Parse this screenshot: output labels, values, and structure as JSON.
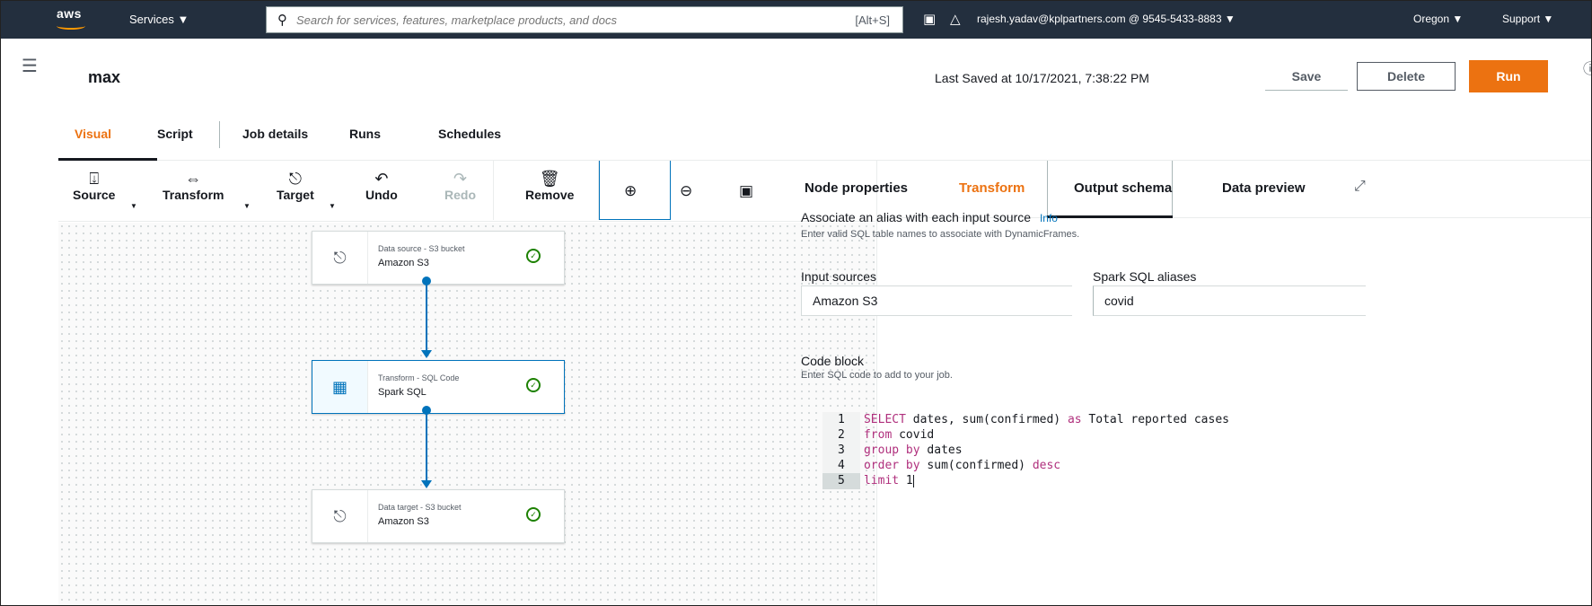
{
  "nav": {
    "logo": "aws",
    "services": "Services ▼",
    "search_placeholder": "Search for services, features, marketplace products, and docs",
    "search_hint": "[Alt+S]",
    "account": "rajesh.yadav@kplpartners.com @ 9545-5433-8883 ▼",
    "region": "Oregon ▼",
    "support": "Support ▼"
  },
  "header": {
    "job_name": "max",
    "last_saved": "Last Saved at 10/17/2021, 7:38:22 PM",
    "save_label": "Save",
    "delete_label": "Delete",
    "run_label": "Run"
  },
  "tabs": [
    "Visual",
    "Script",
    "Job details",
    "Runs",
    "Schedules"
  ],
  "toolbar": {
    "source": "Source",
    "transform": "Transform",
    "target": "Target",
    "undo": "Undo",
    "redo": "Redo",
    "remove": "Remove"
  },
  "nodes": [
    {
      "type": "Data source - S3 bucket",
      "name": "Amazon S3"
    },
    {
      "type": "Transform - SQL Code",
      "name": "Spark SQL"
    },
    {
      "type": "Data target - S3 bucket",
      "name": "Amazon S3"
    }
  ],
  "panel_tabs": [
    "Node properties",
    "Transform",
    "Output schema",
    "Data preview"
  ],
  "transform": {
    "alias_title": "Associate an alias with each input source",
    "info": "Info",
    "alias_desc": "Enter valid SQL table names to associate with DynamicFrames.",
    "input_sources_label": "Input sources",
    "aliases_label": "Spark SQL aliases",
    "input_source_value": "Amazon S3",
    "alias_value": "covid",
    "code_title": "Code block",
    "code_desc": "Enter SQL code to add to your job."
  },
  "code_lines": [
    {
      "num": "1",
      "kw": "SELECT",
      "rest": " dates, sum(confirmed) ",
      "kw2": "as",
      "rest2": " Total reported cases"
    },
    {
      "num": "2",
      "kw": "from",
      "rest": " covid",
      "kw2": "",
      "rest2": ""
    },
    {
      "num": "3",
      "kw": "group by",
      "rest": " dates",
      "kw2": "",
      "rest2": ""
    },
    {
      "num": "4",
      "kw": "order by",
      "rest": " sum(confirmed) ",
      "kw2": "desc",
      "rest2": ""
    },
    {
      "num": "5",
      "kw": "limit",
      "rest": " 1",
      "kw2": "",
      "rest2": ""
    }
  ],
  "colors": {
    "nav_bg": "#232f3e",
    "accent": "#ec7211",
    "link": "#0073bb",
    "success": "#1d8102"
  }
}
